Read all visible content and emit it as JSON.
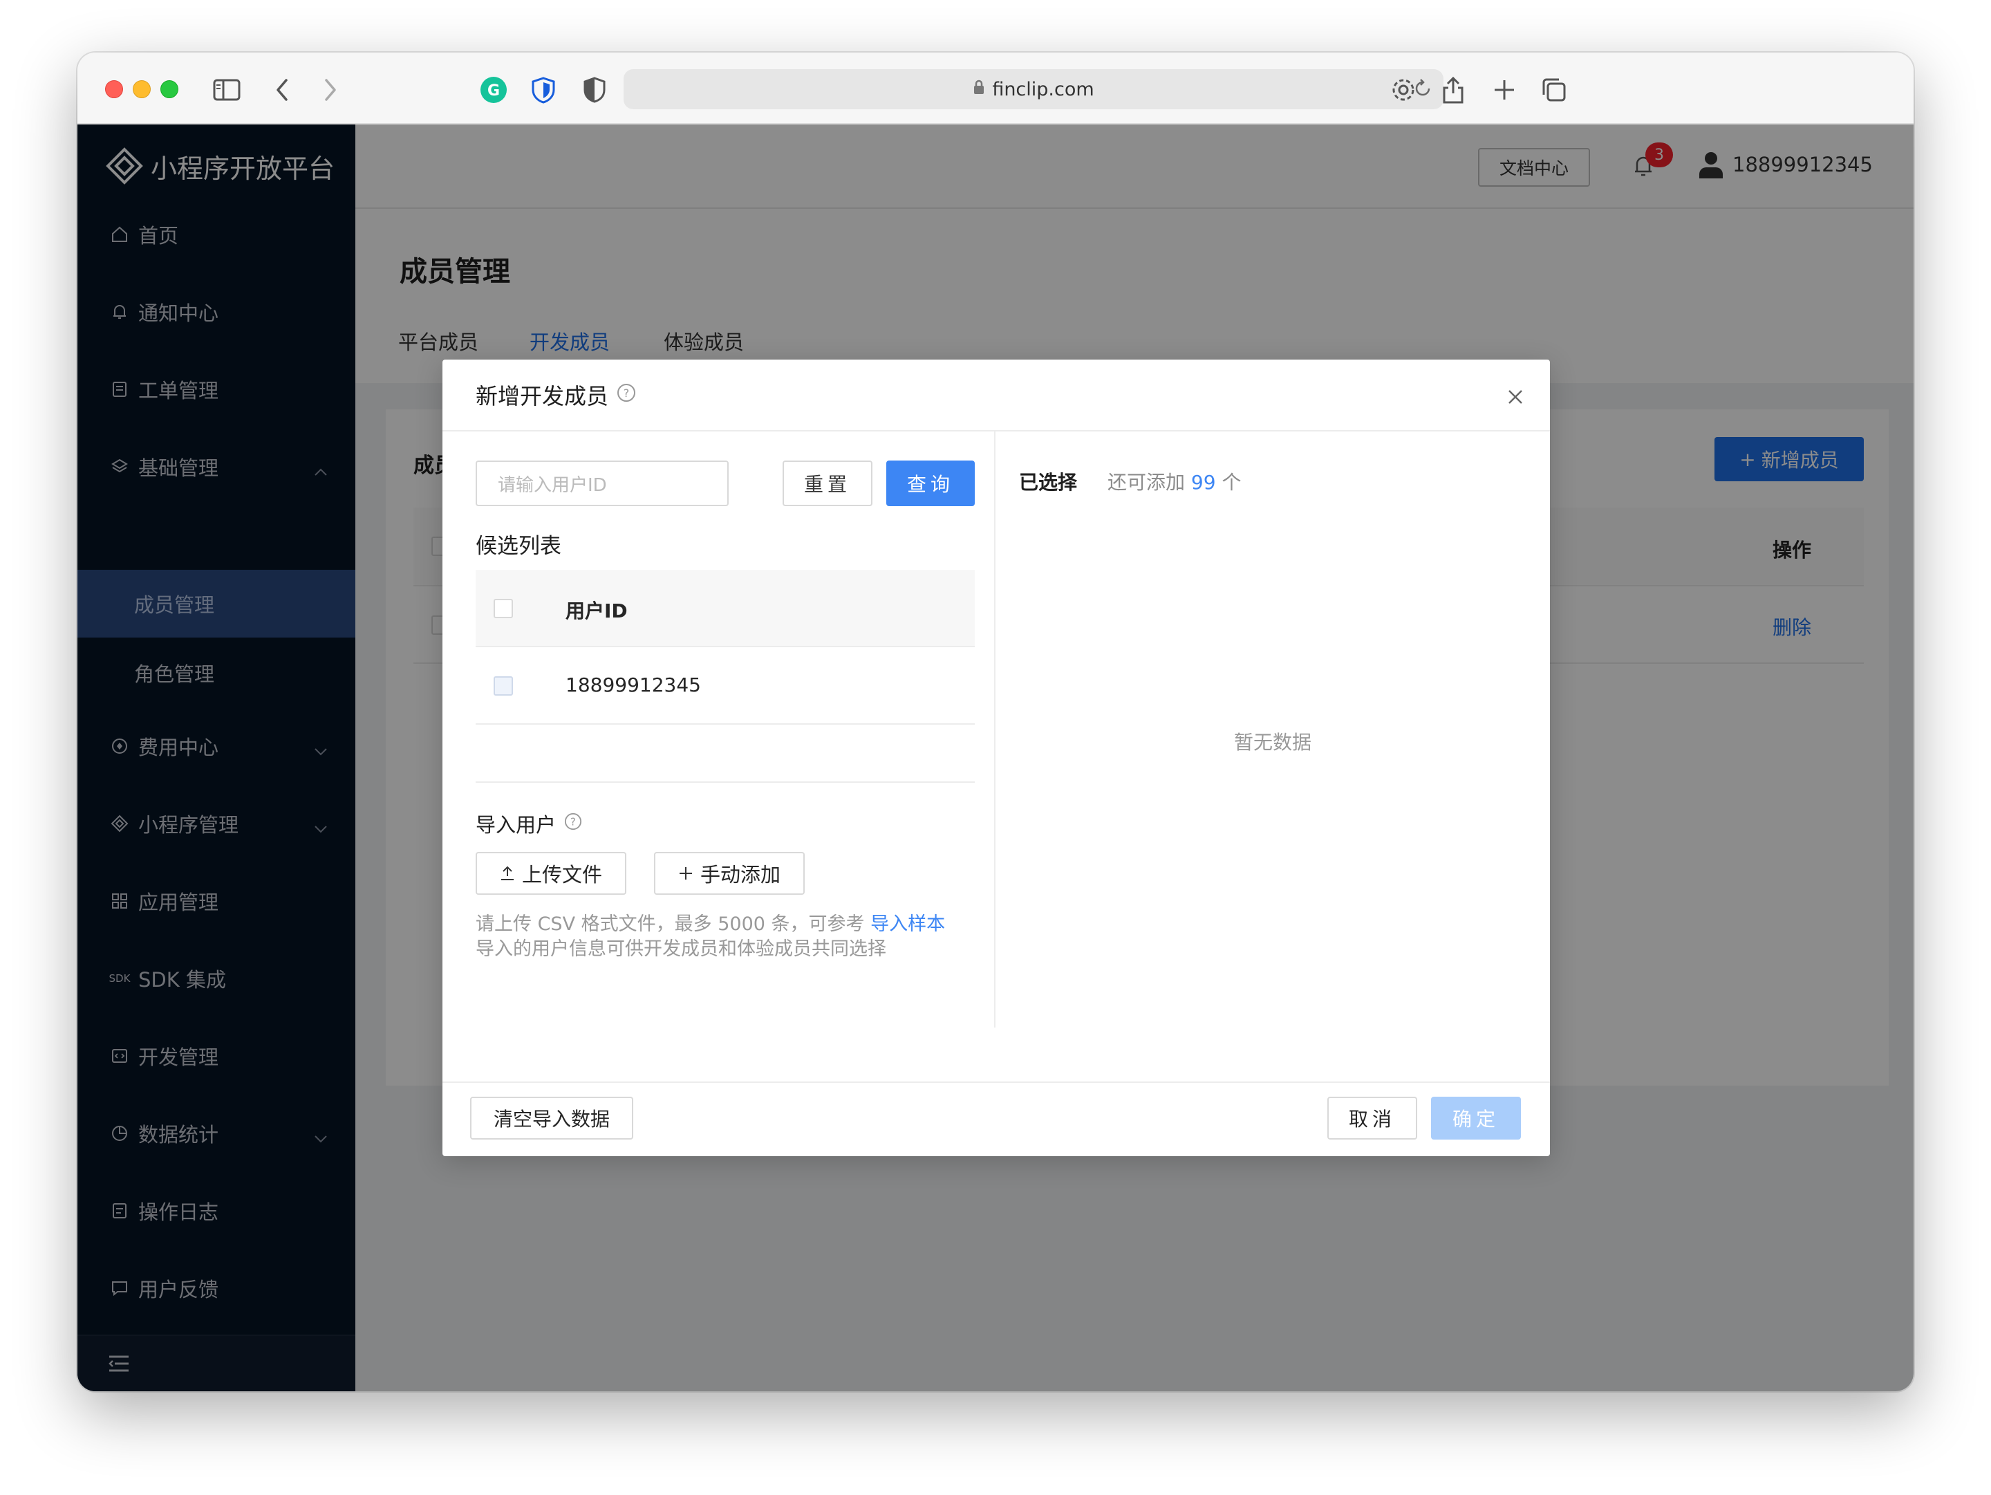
{
  "browser": {
    "url": "finclip.com"
  },
  "sidebar": {
    "brand": "小程序开放平台",
    "items": [
      {
        "label": "首页",
        "icon": "home-icon"
      },
      {
        "label": "通知中心",
        "icon": "bell-icon"
      },
      {
        "label": "工单管理",
        "icon": "ticket-icon"
      },
      {
        "label": "基础管理",
        "icon": "layers-icon",
        "expanded": true
      },
      {
        "label": "成员管理",
        "sub": true,
        "active": true
      },
      {
        "label": "角色管理",
        "sub": true
      },
      {
        "label": "费用中心",
        "icon": "coin-icon"
      },
      {
        "label": "小程序管理",
        "icon": "diamond-icon"
      },
      {
        "label": "应用管理",
        "icon": "grid-icon"
      },
      {
        "label": "SDK 集成",
        "icon": "sdk-icon",
        "icon_text": "SDK"
      },
      {
        "label": "开发管理",
        "icon": "code-icon"
      },
      {
        "label": "数据统计",
        "icon": "chart-icon"
      },
      {
        "label": "操作日志",
        "icon": "log-icon"
      },
      {
        "label": "用户反馈",
        "icon": "feedback-icon"
      }
    ]
  },
  "header": {
    "doc_center": "文档中心",
    "notification_count": "3",
    "username": "18899912345"
  },
  "page": {
    "title": "成员管理",
    "tabs": [
      "平台成员",
      "开发成员",
      "体验成员"
    ],
    "active_tab": "开发成员",
    "card_title": "成员",
    "add_member": "新增成员",
    "op_header": "操作",
    "delete_label": "删除"
  },
  "modal": {
    "title": "新增开发成员",
    "search_placeholder": "请输入用户ID",
    "reset": "重置",
    "query": "查询",
    "candidate_label": "候选列表",
    "column_user_id": "用户ID",
    "rows": [
      "18899912345"
    ],
    "import_label": "导入用户",
    "upload_file": "上传文件",
    "manual_add": "手动添加",
    "hint_line1": "请上传 CSV 格式文件，最多 5000 条，可参考",
    "hint_link": "导入样本",
    "hint_line2": "导入的用户信息可供开发成员和体验成员共同选择",
    "selected_label": "已选择",
    "remain_prefix": "还可添加",
    "remain_count": "99",
    "remain_suffix": "个",
    "empty_text": "暂无数据",
    "clear_import": "清空导入数据",
    "cancel": "取消",
    "confirm": "确定"
  },
  "colors": {
    "primary": "#1f6fe5",
    "sidebar_bg": "#071426",
    "sidebar_active": "#2a4a80",
    "disabled_primary": "#a9cdfb"
  }
}
